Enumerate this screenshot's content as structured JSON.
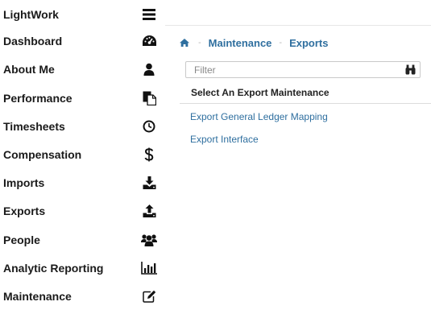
{
  "app": {
    "title": "LightWork",
    "menu_icon": "hamburger-icon"
  },
  "sidebar": {
    "items": [
      {
        "label": "Dashboard",
        "icon": "dashboard-icon"
      },
      {
        "label": "About Me",
        "icon": "user-icon"
      },
      {
        "label": "Performance",
        "icon": "documents-icon"
      },
      {
        "label": "Timesheets",
        "icon": "clock-icon"
      },
      {
        "label": "Compensation",
        "icon": "dollar-icon"
      },
      {
        "label": "Imports",
        "icon": "download-icon"
      },
      {
        "label": "Exports",
        "icon": "upload-icon"
      },
      {
        "label": "People",
        "icon": "users-icon"
      },
      {
        "label": "Analytic Reporting",
        "icon": "bar-chart-icon"
      },
      {
        "label": "Maintenance",
        "icon": "edit-icon"
      }
    ]
  },
  "breadcrumb": {
    "home_icon": "home-icon",
    "items": [
      "Maintenance",
      "Exports"
    ],
    "separator": "-"
  },
  "filter": {
    "placeholder": "Filter",
    "value": "",
    "icon": "binoculars-icon"
  },
  "section": {
    "title": "Select An Export Maintenance",
    "links": [
      "Export General Ledger Mapping",
      "Export Interface"
    ]
  },
  "colors": {
    "link": "#2f6f9f",
    "text": "#1a1a1a"
  }
}
